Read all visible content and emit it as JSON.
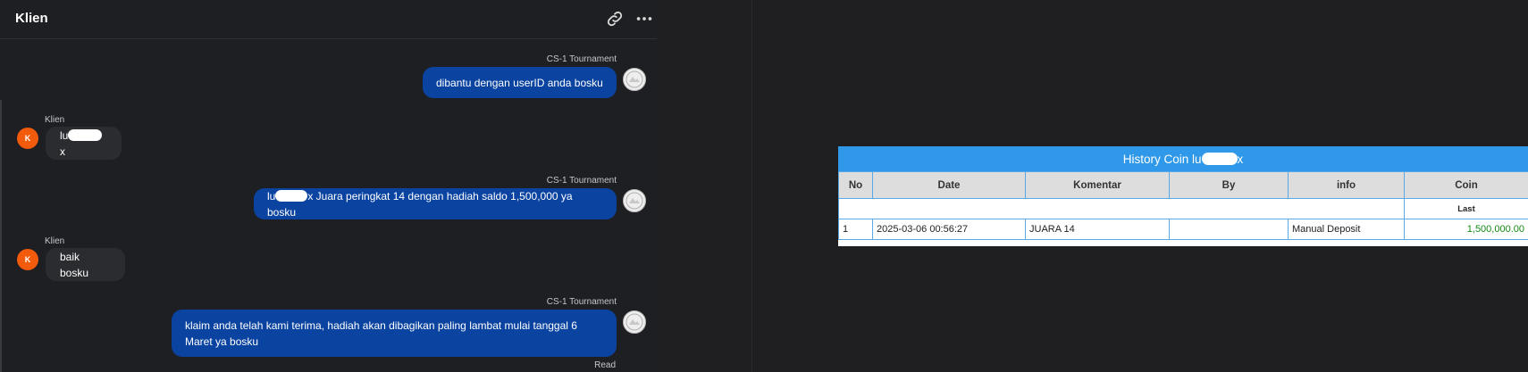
{
  "chat": {
    "title": "Klien",
    "header_icons": [
      "link-icon",
      "more-icon"
    ],
    "messages": [
      {
        "direction": "out",
        "sender": "CS-1 Tournament",
        "text": "dibantu dengan userID anda bosku"
      },
      {
        "direction": "in",
        "sender": "Klien",
        "avatar": "K",
        "text_start": "lu",
        "text_end": "x"
      },
      {
        "direction": "out",
        "sender": "CS-1 Tournament",
        "text_start": "lu",
        "text_end": "x Juara peringkat 14 dengan hadiah saldo 1,500,000 ya bosku"
      },
      {
        "direction": "in",
        "sender": "Klien",
        "avatar": "K",
        "text": "baik bosku"
      },
      {
        "direction": "out",
        "sender": "CS-1 Tournament",
        "text_line1": "klaim anda telah kami terima, hadiah akan dibagikan paling lambat mulai tanggal 6",
        "text_line2": "Maret ya bosku",
        "status": "Read"
      }
    ]
  },
  "history": {
    "title_start": "History Coin lu",
    "title_end": "x",
    "columns": [
      "No",
      "Date",
      "Komentar",
      "By",
      "info",
      "Coin"
    ],
    "subheader": "Last",
    "rows": [
      {
        "no": "1",
        "date": "2025-03-06 00:56:27",
        "komentar": "JUARA 14",
        "by": "",
        "info": "Manual Deposit",
        "coin": "1,500,000.00"
      }
    ],
    "coin_color": "#138a13",
    "header_color": "#2f98e8"
  },
  "colors": {
    "outgoing_bubble": "#0a43a0",
    "incoming_bubble": "#2b2c30",
    "client_avatar": "#f25a0c"
  }
}
